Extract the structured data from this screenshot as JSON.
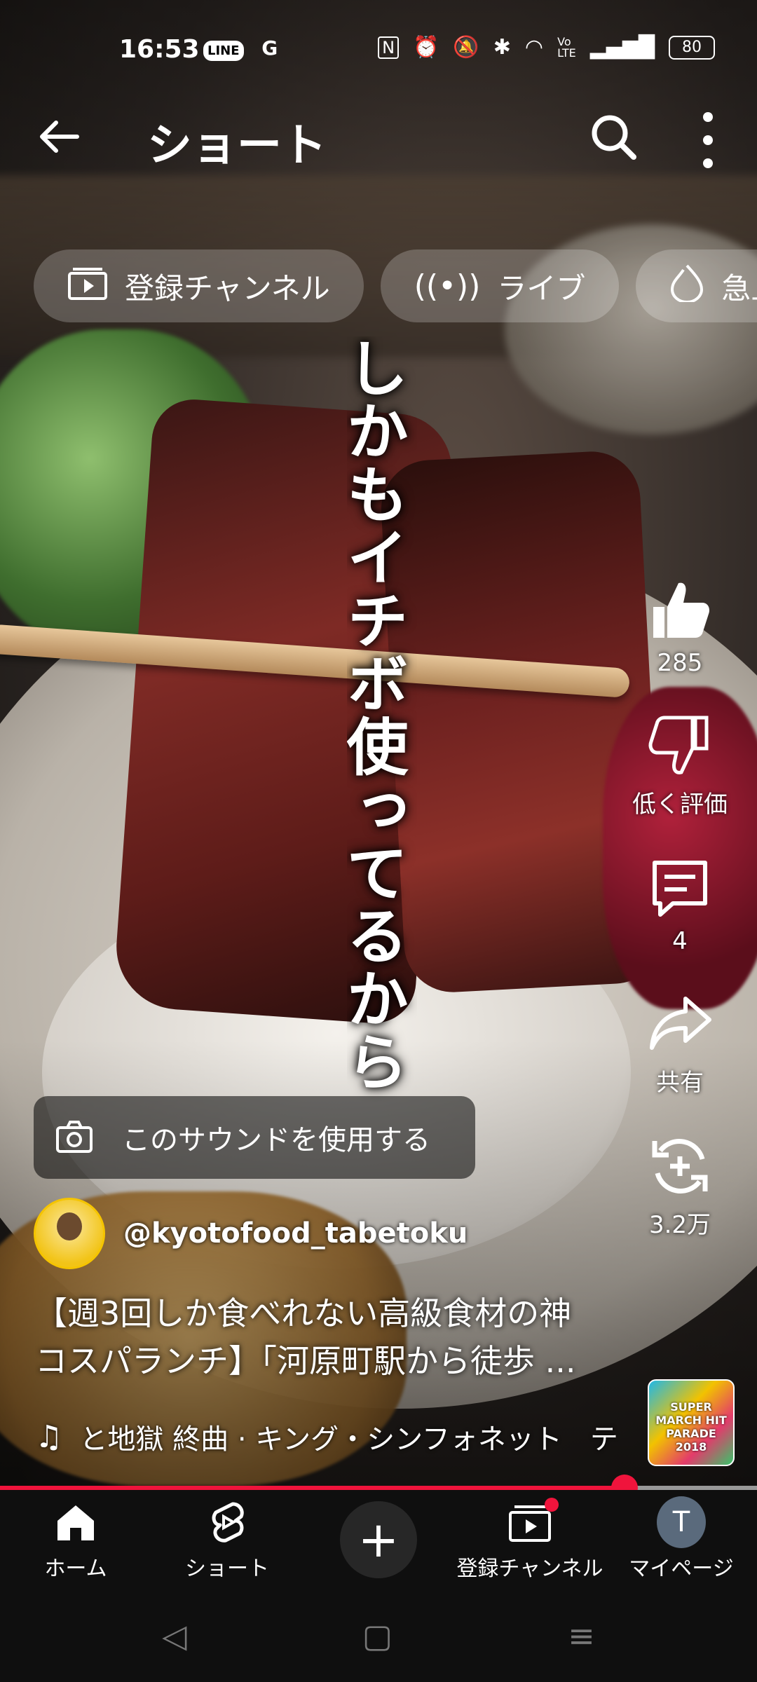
{
  "status_bar": {
    "time": "16:53",
    "apps": [
      "LINE",
      "G"
    ],
    "nfc": "N",
    "battery": "80"
  },
  "header": {
    "title": "ショート"
  },
  "chips": [
    {
      "label": "登録チャンネル",
      "icon": "subscriptions-icon"
    },
    {
      "label": "ライブ",
      "icon": "live-icon"
    },
    {
      "label": "急上",
      "icon": "trending-icon"
    }
  ],
  "video": {
    "overlay_caption": "しかもイチボ使ってるから"
  },
  "actions": {
    "like_count": "285",
    "dislike_label": "低く評価",
    "comment_count": "4",
    "share_label": "共有",
    "remix_count": "3.2万"
  },
  "sound_button": {
    "label": "このサウンドを使用する"
  },
  "channel": {
    "handle": "@kyotofood_tabetoku"
  },
  "description": {
    "line1": "【週3回しか食べれない高級食材の神",
    "line2": "コスパランチ】「河原町駅から徒歩 ..."
  },
  "music": {
    "text": "と地獄 終曲 · キング・シンフォネット　テ"
  },
  "album": {
    "art_text": "SUPER MARCH HIT PARADE 2018"
  },
  "progress": {
    "fraction": 0.825
  },
  "bottom_nav": {
    "home": "ホーム",
    "shorts": "ショート",
    "subscriptions": "登録チャンネル",
    "mypage": "マイページ",
    "avatar_letter": "T"
  },
  "colors": {
    "accent": "#f0143c",
    "nav_bg": "#0f0f0f"
  }
}
